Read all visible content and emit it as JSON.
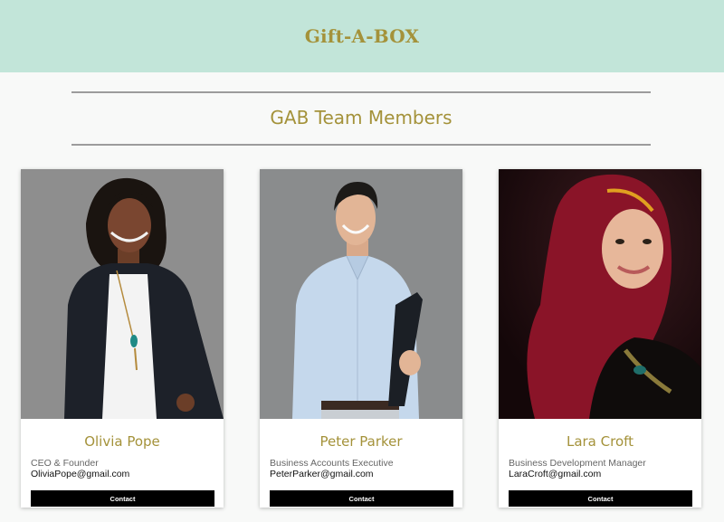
{
  "header": {
    "brand": "Gift-A-BOX",
    "background": "#c2e5d9",
    "accent": "#a4923a"
  },
  "section": {
    "title": "GAB Team Members"
  },
  "members": [
    {
      "photo": "woman-in-black-blazer-portrait",
      "name": "Olivia Pope",
      "role": "CEO & Founder",
      "email": "OliviaPope@gmail.com",
      "contact_label": "Contact"
    },
    {
      "photo": "man-in-light-blue-shirt-holding-folder-portrait",
      "name": "Peter Parker",
      "role": "Business Accounts Executive",
      "email": "PeterParker@gmail.com",
      "contact_label": "Contact"
    },
    {
      "photo": "woman-in-red-hijab-portrait",
      "name": "Lara Croft",
      "role": "Business Development Manager",
      "email": "LaraCroft@gmail.com",
      "contact_label": "Contact"
    }
  ]
}
